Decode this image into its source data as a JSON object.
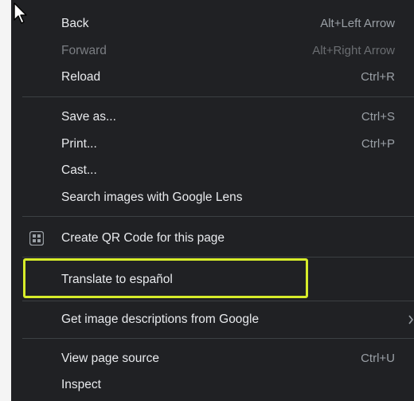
{
  "context_menu": {
    "items": [
      {
        "label": "Back",
        "shortcut": "Alt+Left Arrow"
      },
      {
        "label": "Forward",
        "shortcut": "Alt+Right Arrow",
        "disabled": true
      },
      {
        "label": "Reload",
        "shortcut": "Ctrl+R"
      },
      {
        "label": "Save as...",
        "shortcut": "Ctrl+S"
      },
      {
        "label": "Print...",
        "shortcut": "Ctrl+P"
      },
      {
        "label": "Cast..."
      },
      {
        "label": "Search images with Google Lens"
      },
      {
        "label": "Create QR Code for this page",
        "icon": "qr-code-icon"
      },
      {
        "label": "Translate to español"
      },
      {
        "label": "Get image descriptions from Google",
        "icon": "chevron-right-icon"
      },
      {
        "label": "View page source",
        "shortcut": "Ctrl+U"
      },
      {
        "label": "Inspect"
      }
    ]
  },
  "colors": {
    "menu_background": "#202124",
    "text": "#e8eaed",
    "shortcut_text": "#9aa0a6",
    "highlight_border": "#d7ec2a"
  }
}
